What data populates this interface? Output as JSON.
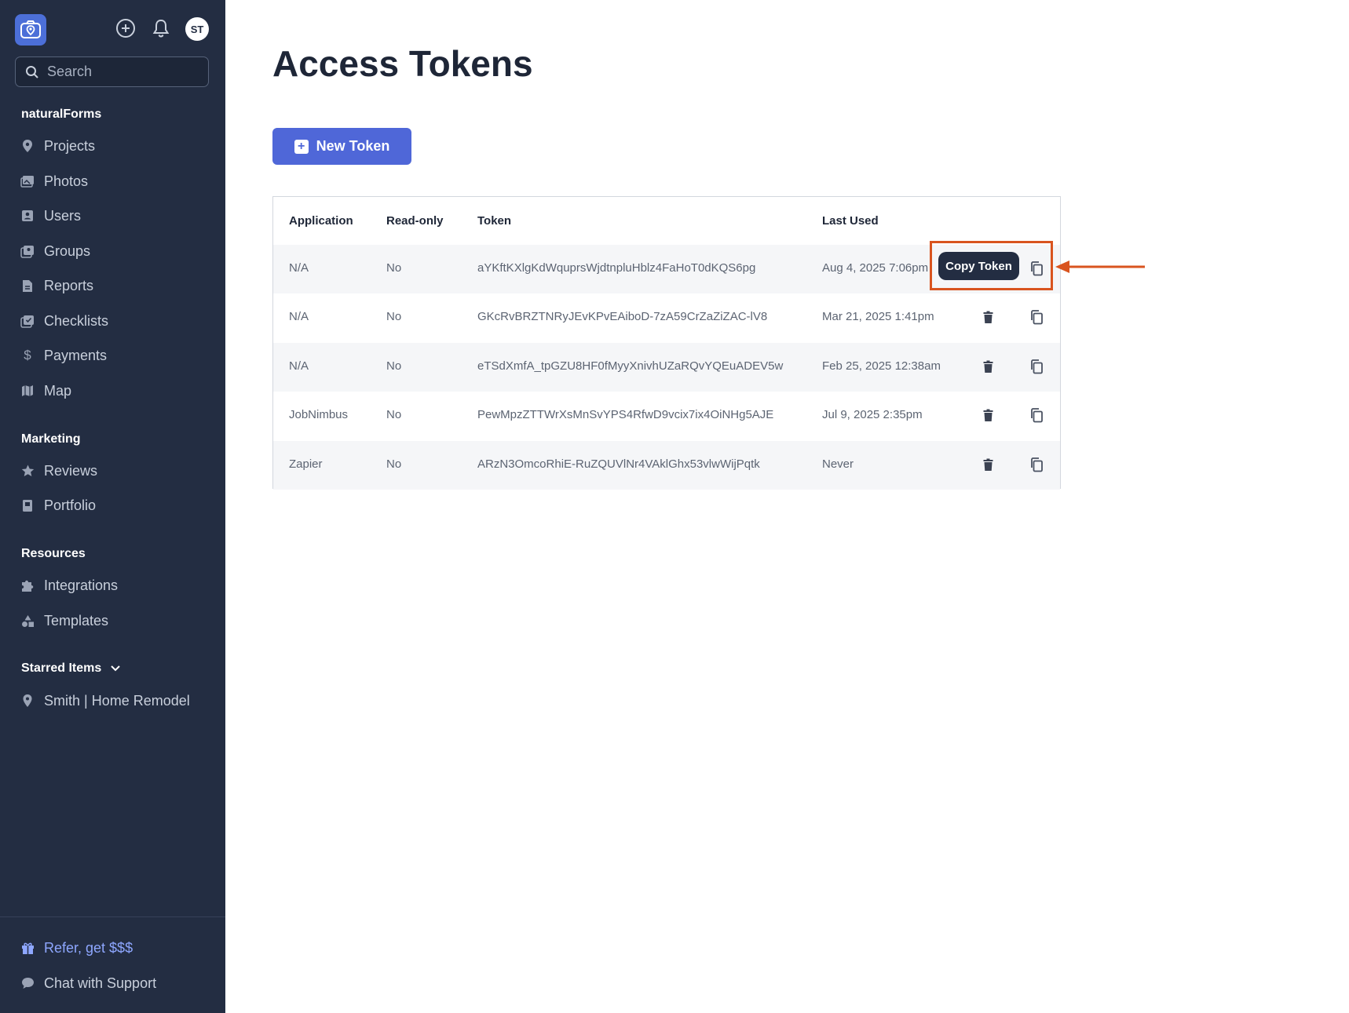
{
  "sidebar": {
    "avatar_initials": "ST",
    "search_placeholder": "Search",
    "section_main": "naturalForms",
    "main_items": [
      {
        "label": "Projects",
        "icon": "map-pin-icon"
      },
      {
        "label": "Photos",
        "icon": "photos-icon"
      },
      {
        "label": "Users",
        "icon": "user-card-icon"
      },
      {
        "label": "Groups",
        "icon": "groups-icon"
      },
      {
        "label": "Reports",
        "icon": "report-icon"
      },
      {
        "label": "Checklists",
        "icon": "checklist-icon"
      },
      {
        "label": "Payments",
        "icon": "dollar-icon"
      },
      {
        "label": "Map",
        "icon": "map-icon"
      }
    ],
    "section_marketing": "Marketing",
    "marketing_items": [
      {
        "label": "Reviews",
        "icon": "star-icon"
      },
      {
        "label": "Portfolio",
        "icon": "portfolio-icon"
      }
    ],
    "section_resources": "Resources",
    "resources_items": [
      {
        "label": "Integrations",
        "icon": "puzzle-icon"
      },
      {
        "label": "Templates",
        "icon": "shapes-icon"
      }
    ],
    "section_starred": "Starred Items",
    "starred_items": [
      {
        "label": "Smith | Home Remodel",
        "icon": "location-pin-icon"
      }
    ],
    "footer_items": [
      {
        "label": "Refer, get $$$",
        "icon": "gift-icon"
      },
      {
        "label": "Chat with Support",
        "icon": "chat-icon"
      }
    ]
  },
  "main": {
    "title": "Access Tokens",
    "new_token_label": "New Token",
    "table": {
      "headers": [
        "Application",
        "Read-only",
        "Token",
        "Last Used"
      ],
      "rows": [
        {
          "application": "N/A",
          "read_only": "No",
          "token": "aYKftKXlgKdWquprsWjdtnpluHblz4FaHoT0dKQS6pg",
          "last_used": "Aug 4, 2025 7:06pm"
        },
        {
          "application": "N/A",
          "read_only": "No",
          "token": "GKcRvBRZTNRyJEvKPvEAiboD-7zA59CrZaZiZAC-lV8",
          "last_used": "Mar 21, 2025 1:41pm"
        },
        {
          "application": "N/A",
          "read_only": "No",
          "token": "eTSdXmfA_tpGZU8HF0fMyyXnivhUZaRQvYQEuADEV5w",
          "last_used": "Feb 25, 2025 12:38am"
        },
        {
          "application": "JobNimbus",
          "read_only": "No",
          "token": "PewMpzZTTWrXsMnSvYPS4RfwD9vcix7ix4OiNHg5AJE",
          "last_used": "Jul 9, 2025 2:35pm"
        },
        {
          "application": "Zapier",
          "read_only": "No",
          "token": "ARzN3OmcoRhiE-RuZQUVlNr4VAklGhx53vlwWijPqtk",
          "last_used": "Never"
        }
      ]
    },
    "tooltip": "Copy Token"
  },
  "colors": {
    "sidebar_bg": "#232d42",
    "primary": "#4f67d8",
    "highlight": "#d9541f"
  }
}
